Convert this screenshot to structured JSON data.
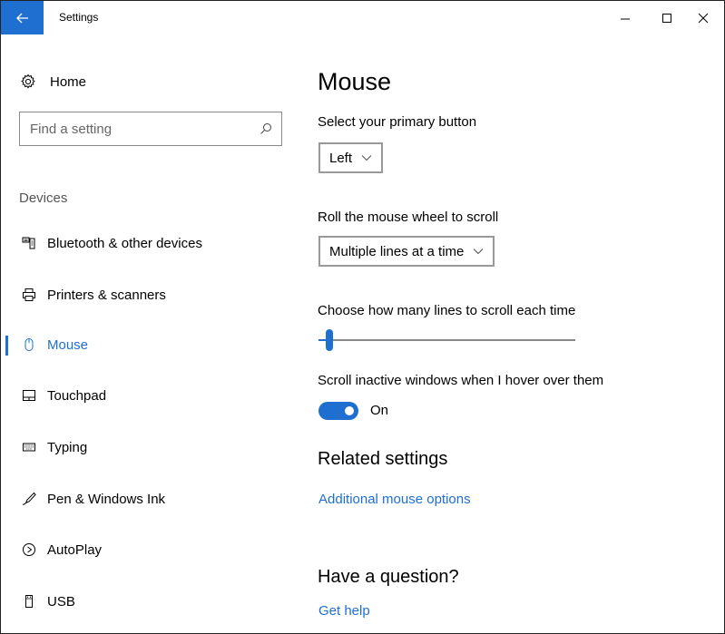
{
  "window": {
    "title": "Settings",
    "controls": {
      "minimize": "minimize",
      "maximize": "maximize",
      "close": "close"
    }
  },
  "sidebar": {
    "home_label": "Home",
    "search_placeholder": "Find a setting",
    "section_label": "Devices",
    "items": [
      {
        "label": "Bluetooth & other devices",
        "icon": "bluetooth-devices-icon",
        "active": false
      },
      {
        "label": "Printers & scanners",
        "icon": "printer-icon",
        "active": false
      },
      {
        "label": "Mouse",
        "icon": "mouse-icon",
        "active": true
      },
      {
        "label": "Touchpad",
        "icon": "touchpad-icon",
        "active": false
      },
      {
        "label": "Typing",
        "icon": "keyboard-icon",
        "active": false
      },
      {
        "label": "Pen & Windows Ink",
        "icon": "pen-icon",
        "active": false
      },
      {
        "label": "AutoPlay",
        "icon": "autoplay-icon",
        "active": false
      },
      {
        "label": "USB",
        "icon": "usb-icon",
        "active": false
      }
    ]
  },
  "main": {
    "title": "Mouse",
    "primary_button": {
      "label": "Select your primary button",
      "value": "Left"
    },
    "wheel_scroll": {
      "label": "Roll the mouse wheel to scroll",
      "value": "Multiple lines at a time"
    },
    "lines_to_scroll": {
      "label": "Choose how many lines to scroll each time",
      "value_fraction": 0.03
    },
    "inactive_scroll": {
      "label": "Scroll inactive windows when I hover over them",
      "state": "On"
    },
    "related": {
      "heading": "Related settings",
      "link": "Additional mouse options"
    },
    "question": {
      "heading": "Have a question?",
      "link": "Get help"
    }
  },
  "colors": {
    "accent": "#1f6fd0"
  }
}
